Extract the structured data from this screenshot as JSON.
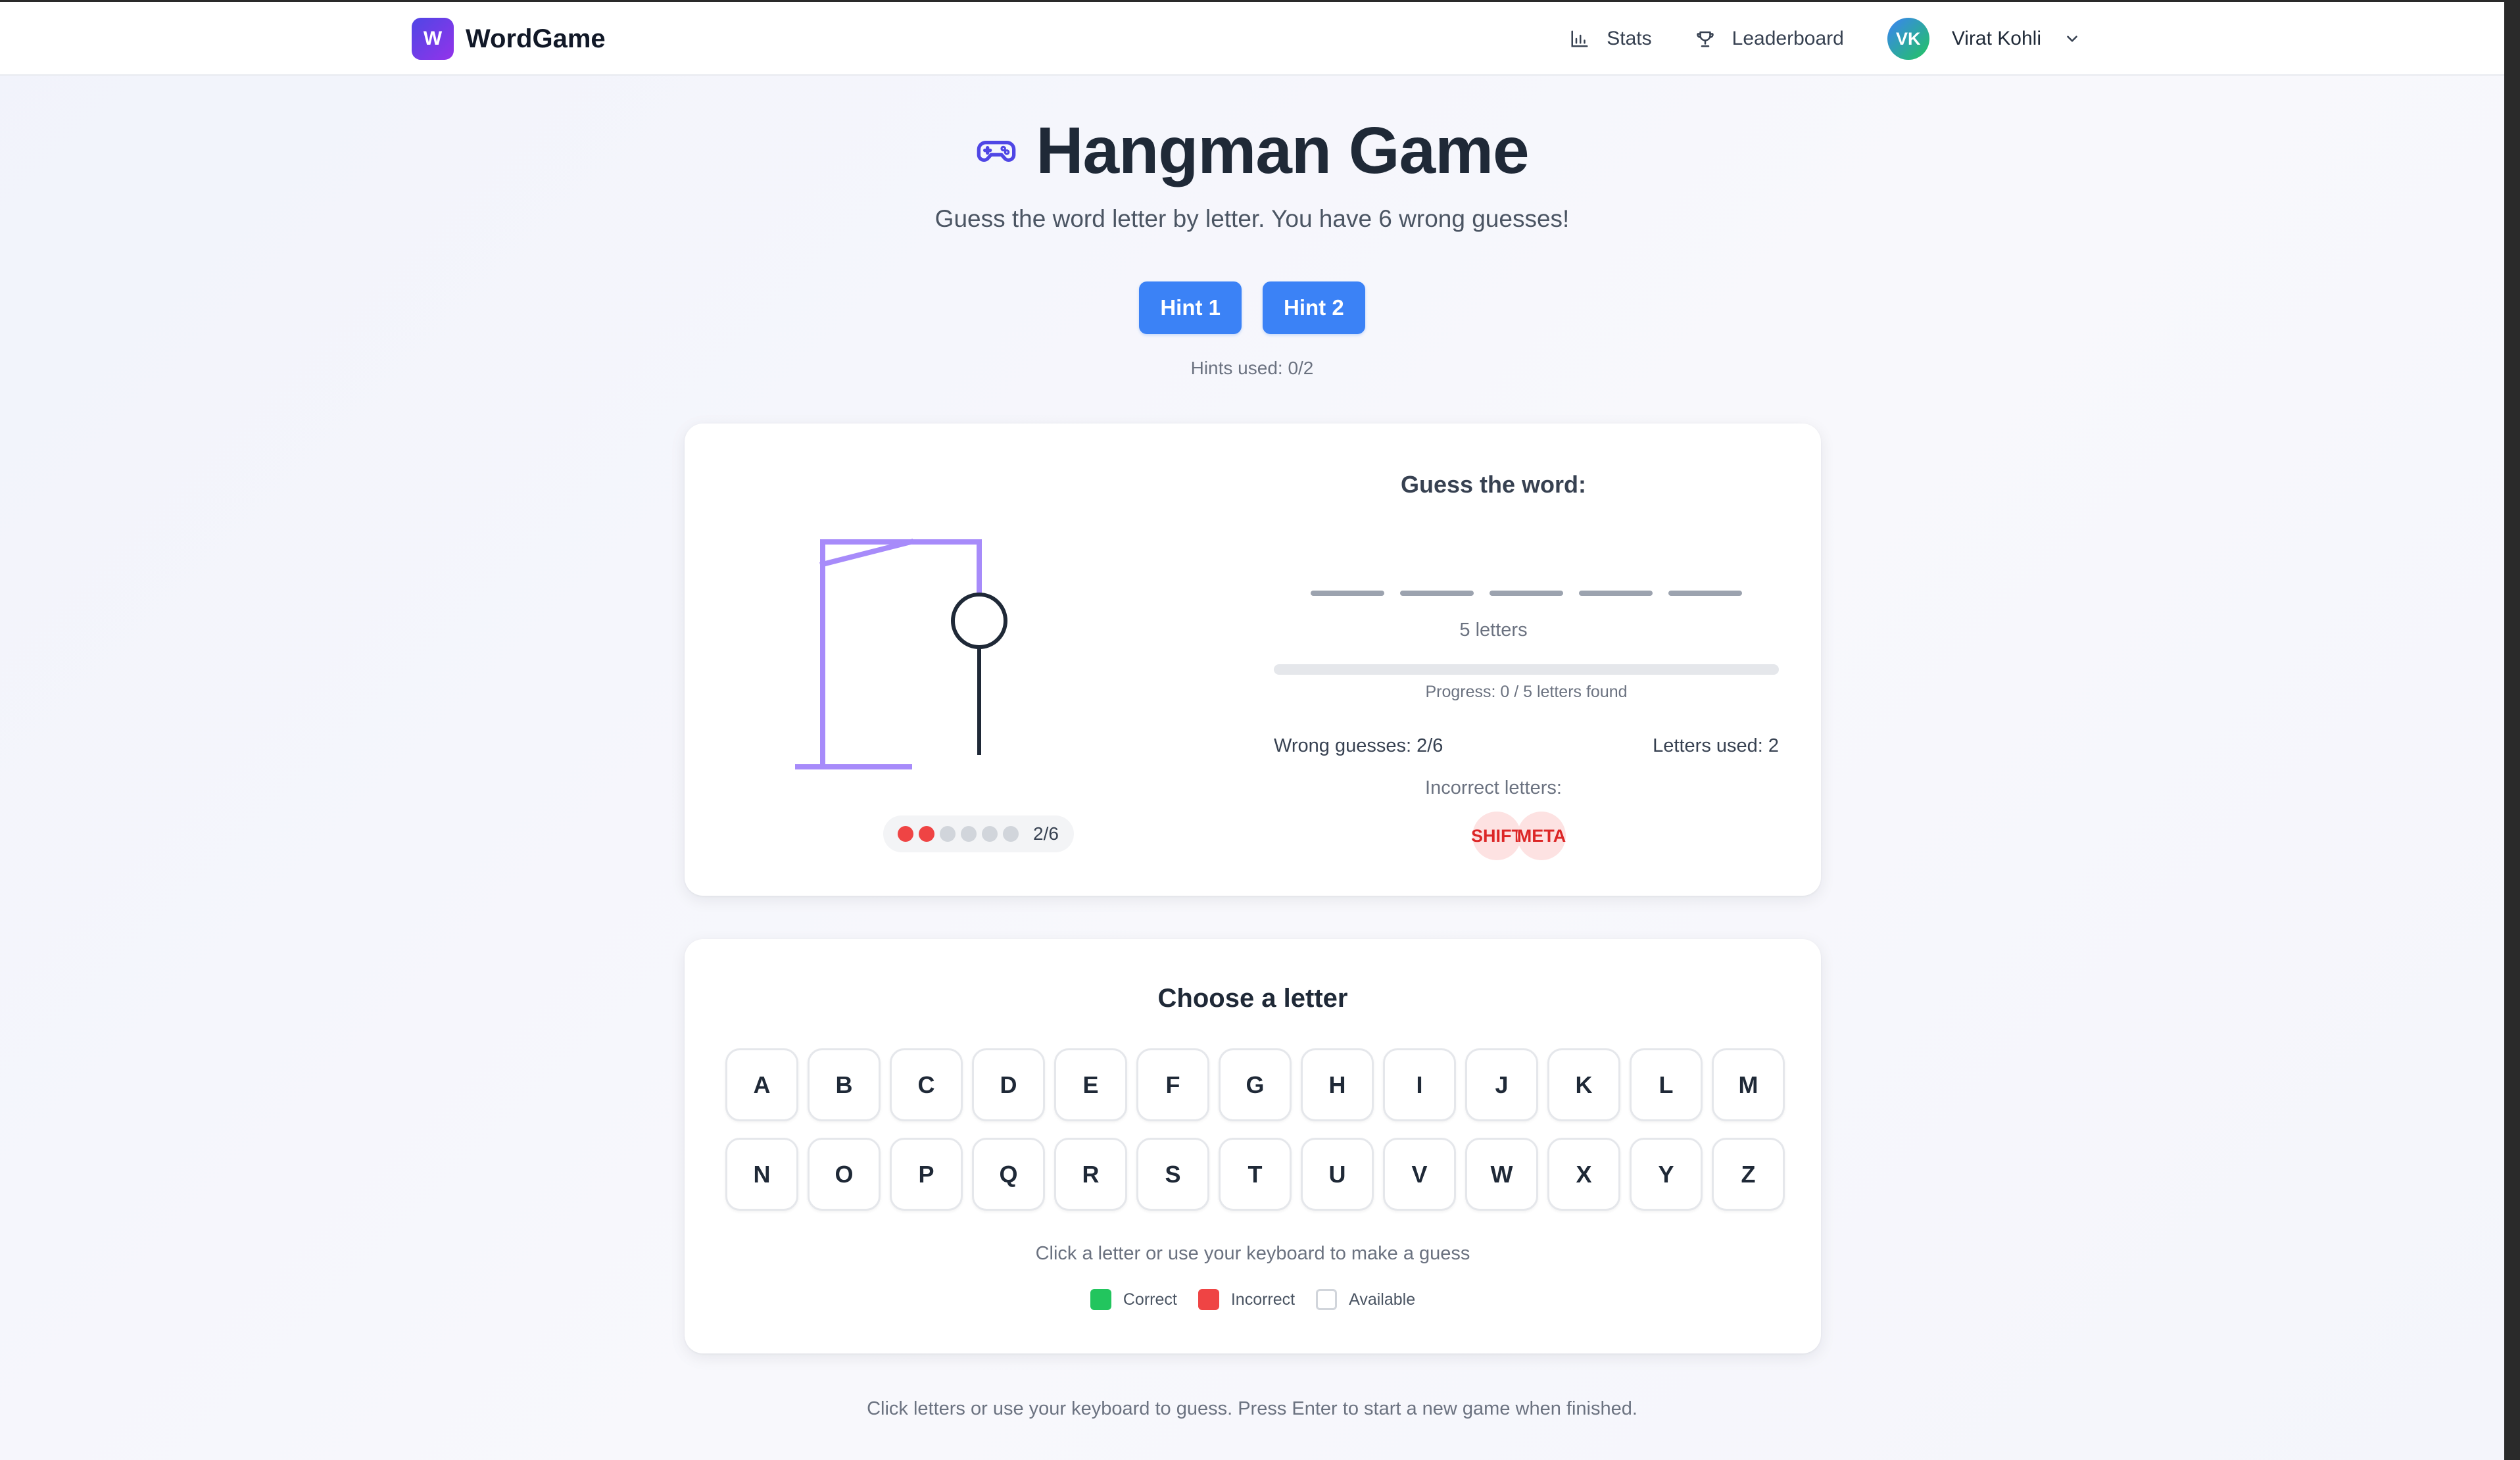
{
  "navbar": {
    "logo_letter": "W",
    "brand": "WordGame",
    "stats_label": "Stats",
    "leaderboard_label": "Leaderboard",
    "user_initials": "VK",
    "user_name": "Virat Kohli"
  },
  "header": {
    "title": "Hangman Game",
    "subtitle": "Guess the word letter by letter. You have 6 wrong guesses!",
    "hint1_label": "Hint 1",
    "hint2_label": "Hint 2",
    "hints_used": "Hints used: 0/2"
  },
  "game": {
    "lives_total": 6,
    "lives_lost": 2,
    "lives_text": "2/6",
    "guess_title": "Guess the word:",
    "word_length": 5,
    "letters_count": "5 letters",
    "progress_fraction": 0,
    "progress_text": "Progress: 0 / 5 letters found",
    "wrong_guesses": "Wrong guesses: 2/6",
    "letters_used": "Letters used: 2",
    "incorrect_title": "Incorrect letters:",
    "incorrect_letters": [
      "SHIFT",
      "META"
    ]
  },
  "keyboard": {
    "title": "Choose a letter",
    "letters": [
      "A",
      "B",
      "C",
      "D",
      "E",
      "F",
      "G",
      "H",
      "I",
      "J",
      "K",
      "L",
      "M",
      "N",
      "O",
      "P",
      "Q",
      "R",
      "S",
      "T",
      "U",
      "V",
      "W",
      "X",
      "Y",
      "Z"
    ],
    "help": "Click a letter or use your keyboard to make a guess",
    "legend": {
      "correct": "Correct",
      "incorrect": "Incorrect",
      "available": "Available"
    }
  },
  "footer": {
    "note": "Click letters or use your keyboard to guess. Press Enter to start a new game when finished."
  },
  "colors": {
    "accent": "#3b82f6",
    "gallows": "#a78bfa",
    "incorrect": "#ef4444",
    "correct": "#22c55e"
  },
  "icons": {
    "stats": "bar-chart-icon",
    "leaderboard": "trophy-icon",
    "title": "gamepad-icon",
    "user_menu": "chevron-down-icon"
  }
}
